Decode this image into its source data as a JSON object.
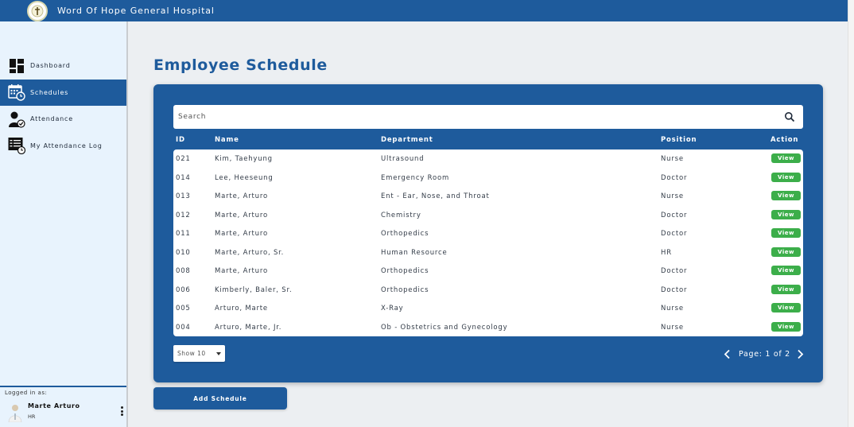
{
  "header": {
    "title": "Word Of Hope General Hospital"
  },
  "sidebar": {
    "items": [
      {
        "label": "Dashboard",
        "icon": "dashboard-icon",
        "active": false
      },
      {
        "label": "Schedules",
        "icon": "calendar-clock-icon",
        "active": true
      },
      {
        "label": "Attendance",
        "icon": "user-check-icon",
        "active": false
      },
      {
        "label": "My Attendance Log",
        "icon": "log-list-icon",
        "active": false
      }
    ],
    "user": {
      "logged_in_label": "Logged in as:",
      "name": "Marte Arturo",
      "role": "HR"
    }
  },
  "main": {
    "title": "Employee Schedule",
    "search": {
      "placeholder": "Search",
      "value": ""
    },
    "columns": {
      "id": "ID",
      "name": "Name",
      "department": "Department",
      "position": "Position",
      "action": "Action"
    },
    "rows": [
      {
        "id": "021",
        "name": "Kim, Taehyung",
        "department": "Ultrasound",
        "position": "Nurse",
        "action": "View"
      },
      {
        "id": "014",
        "name": "Lee, Heeseung",
        "department": "Emergency Room",
        "position": "Doctor",
        "action": "View"
      },
      {
        "id": "013",
        "name": "Marte, Arturo",
        "department": "Ent - Ear, Nose, and Throat",
        "position": "Nurse",
        "action": "View"
      },
      {
        "id": "012",
        "name": "Marte, Arturo",
        "department": "Chemistry",
        "position": "Doctor",
        "action": "View"
      },
      {
        "id": "011",
        "name": "Marte, Arturo",
        "department": "Orthopedics",
        "position": "Doctor",
        "action": "View"
      },
      {
        "id": "010",
        "name": "Marte, Arturo, Sr.",
        "department": "Human Resource",
        "position": "HR",
        "action": "View"
      },
      {
        "id": "008",
        "name": "Marte, Arturo",
        "department": "Orthopedics",
        "position": "Doctor",
        "action": "View"
      },
      {
        "id": "006",
        "name": "Kimberly, Baler, Sr.",
        "department": "Orthopedics",
        "position": "Doctor",
        "action": "View"
      },
      {
        "id": "005",
        "name": "Arturo, Marte",
        "department": "X-Ray",
        "position": "Nurse",
        "action": "View"
      },
      {
        "id": "004",
        "name": "Arturo, Marte, Jr.",
        "department": "Ob - Obstetrics and Gynecology",
        "position": "Nurse",
        "action": "View"
      }
    ],
    "show_select": {
      "value": "Show 10"
    },
    "pagination": {
      "label": "Page: 1 of 2"
    },
    "add_button": "Add Schedule"
  },
  "colors": {
    "primary": "#1e5b9c",
    "view_button": "#3cae4a",
    "sidebar_bg": "#e8f3fd",
    "page_bg": "#eceff2"
  }
}
